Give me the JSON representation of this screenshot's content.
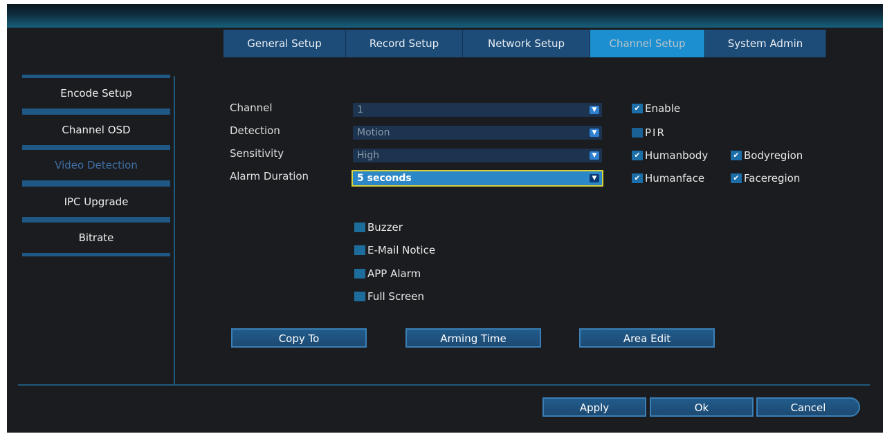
{
  "tabs": [
    {
      "label": "General Setup",
      "active": false
    },
    {
      "label": "Record Setup",
      "active": false
    },
    {
      "label": "Network Setup",
      "active": false
    },
    {
      "label": "Channel Setup",
      "active": true
    },
    {
      "label": "System Admin",
      "active": false
    }
  ],
  "sidebar": {
    "items": [
      {
        "label": "Encode Setup",
        "active": false
      },
      {
        "label": "Channel OSD",
        "active": false
      },
      {
        "label": "Video Detection",
        "active": true
      },
      {
        "label": "IPC Upgrade",
        "active": false
      },
      {
        "label": "Bitrate",
        "active": false
      }
    ]
  },
  "form": {
    "channel": {
      "label": "Channel",
      "value": "1"
    },
    "detection": {
      "label": "Detection",
      "value": "Motion"
    },
    "sensitivity": {
      "label": "Sensitivity",
      "value": "High"
    },
    "alarm_duration": {
      "label": "Alarm Duration",
      "value": "5 seconds"
    }
  },
  "options": {
    "enable": {
      "label": "Enable",
      "checked": true
    },
    "pir": {
      "label": "PIR",
      "checked": false
    },
    "humanbody": {
      "label": "Humanbody",
      "checked": true
    },
    "bodyregion": {
      "label": "Bodyregion",
      "checked": true
    },
    "humanface": {
      "label": "Humanface",
      "checked": true
    },
    "faceregion": {
      "label": "Faceregion",
      "checked": true
    }
  },
  "alarms": {
    "buzzer": {
      "label": "Buzzer",
      "checked": false
    },
    "email": {
      "label": "E-Mail Notice",
      "checked": false
    },
    "app": {
      "label": "APP Alarm",
      "checked": false
    },
    "fullscreen": {
      "label": "Full Screen",
      "checked": false
    }
  },
  "actions": {
    "copy_to": "Copy To",
    "arming_time": "Arming Time",
    "area_edit": "Area Edit"
  },
  "footer": {
    "apply": "Apply",
    "ok": "Ok",
    "cancel": "Cancel"
  },
  "colors": {
    "background": "#1b1c20",
    "tab": "#1e4c78",
    "tab_active": "#1c8fd0",
    "focus_outline": "#d8d23a"
  }
}
